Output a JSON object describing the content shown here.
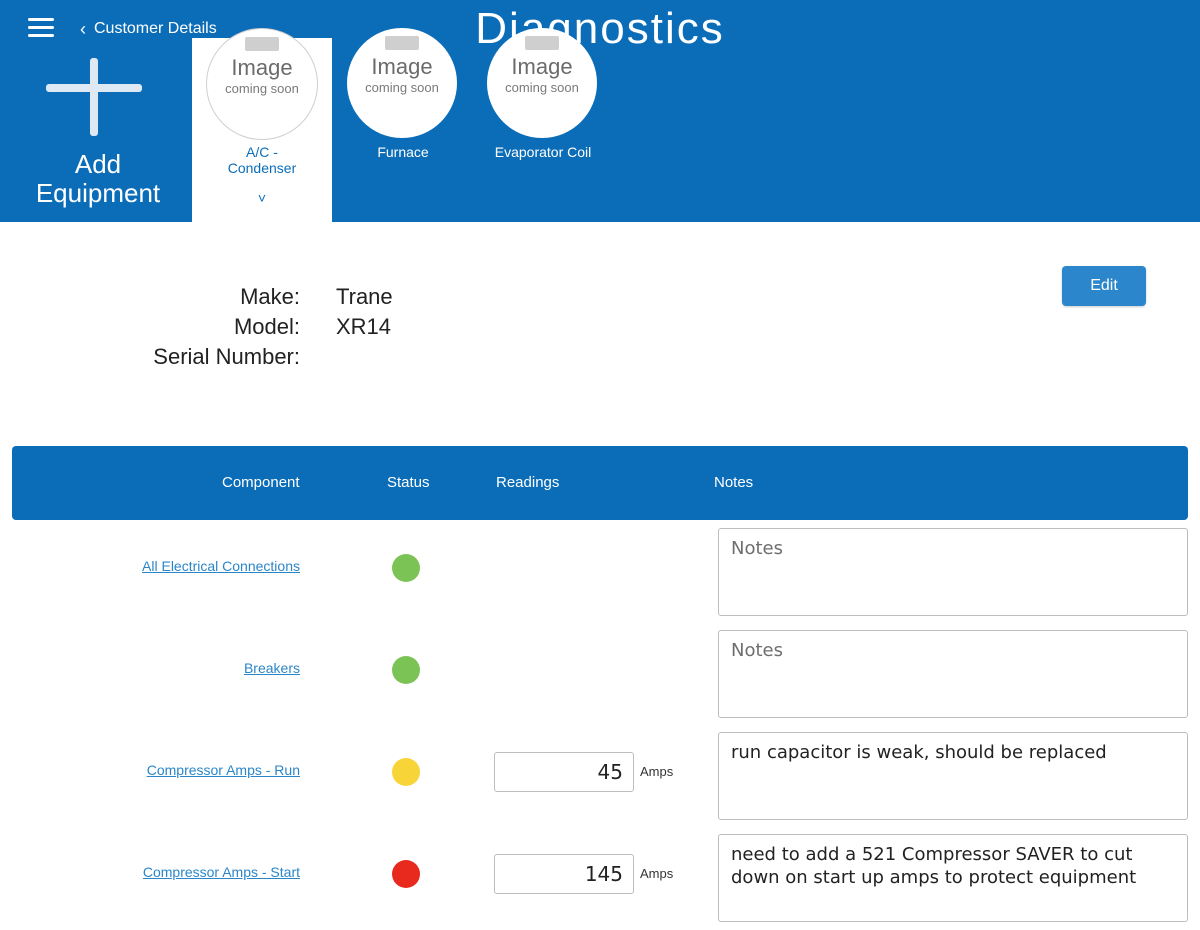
{
  "header": {
    "back_label": "Customer Details",
    "title": "Diagnostics"
  },
  "add_equipment": {
    "label": "Add\nEquipment"
  },
  "equipment": [
    {
      "image_title": "Image",
      "image_subtitle": "coming soon",
      "name": "A/C -\nCondenser",
      "selected": true,
      "caret": "˅"
    },
    {
      "image_title": "Image",
      "image_subtitle": "coming soon",
      "name": "Furnace",
      "selected": false
    },
    {
      "image_title": "Image",
      "image_subtitle": "coming soon",
      "name": "Evaporator Coil",
      "selected": false
    }
  ],
  "details": {
    "make_label": "Make:",
    "make_value": "Trane",
    "model_label": "Model:",
    "model_value": "XR14",
    "serial_label": "Serial Number:",
    "serial_value": "",
    "edit_label": "Edit"
  },
  "table": {
    "headers": {
      "component": "Component",
      "status": "Status",
      "readings": "Readings",
      "notes": "Notes"
    },
    "rows": [
      {
        "component": "All Electrical Connections",
        "status": "green",
        "status_color": "#7cc356",
        "reading": "",
        "unit": "",
        "notes_value": "",
        "notes_placeholder": "Notes"
      },
      {
        "component": "Breakers",
        "status": "green",
        "status_color": "#7cc356",
        "reading": "",
        "unit": "",
        "notes_value": "",
        "notes_placeholder": "Notes"
      },
      {
        "component": "Compressor Amps - Run",
        "status": "yellow",
        "status_color": "#f7d538",
        "reading": "45",
        "unit": "Amps",
        "notes_value": "run capacitor is weak, should be replaced",
        "notes_placeholder": "Notes"
      },
      {
        "component": "Compressor Amps - Start",
        "status": "red",
        "status_color": "#e8291d",
        "reading": "145",
        "unit": "Amps",
        "notes_value": "need to add a 521 Compressor SAVER to cut down on start up amps to protect equipment",
        "notes_placeholder": "Notes"
      }
    ]
  },
  "colors": {
    "brand_blue": "#0b6db8",
    "link_blue": "#2a86c9",
    "button_blue": "#2b86cc"
  }
}
